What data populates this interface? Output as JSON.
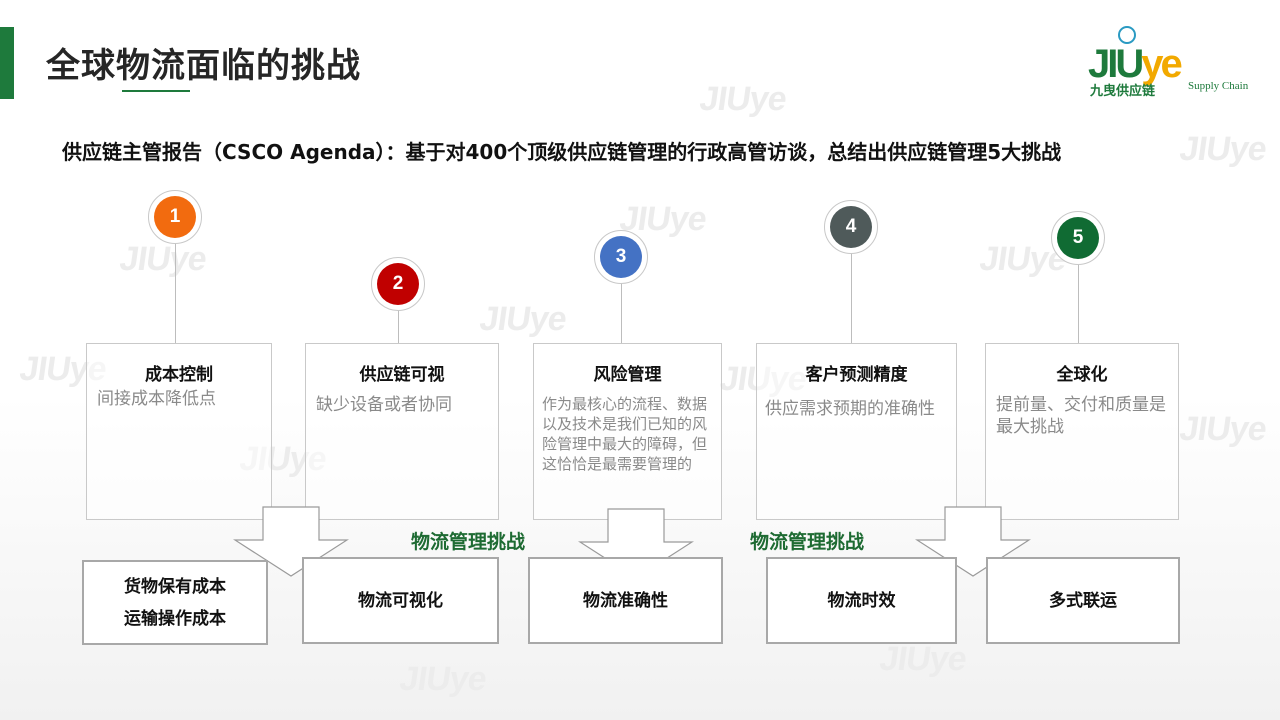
{
  "title": "全球物流面临的挑战",
  "subtitle": "供应链主管报告（CSCO Agenda）：基于对400个顶级供应链管理的行政高管访谈，总结出供应链管理5大挑战",
  "logo": {
    "mark_a": "JIU",
    "mark_b": "ye",
    "cn": "九曳供应链",
    "en": "Supply Chain"
  },
  "watermark_text": "JIUye",
  "challenges": [
    {
      "num": "1",
      "color": "#f26b0f",
      "title": "成本控制",
      "desc": "间接成本降低点"
    },
    {
      "num": "2",
      "color": "#c00000",
      "title": "供应链可视",
      "desc": "缺少设备或者协同"
    },
    {
      "num": "3",
      "color": "#4472c4",
      "title": "风险管理",
      "desc": "作为最核心的流程、数据以及技术是我们已知的风险管理中最大的障碍，但这恰恰是最需要管理的"
    },
    {
      "num": "4",
      "color": "#4f5a5a",
      "title": "客户预测精度",
      "desc": "供应需求预期的准确性"
    },
    {
      "num": "5",
      "color": "#106b33",
      "title": "全球化",
      "desc": "提前量、交付和质量是最大挑战"
    }
  ],
  "logistics_label_1": "物流管理挑战",
  "logistics_label_2": "物流管理挑战",
  "boxes": [
    {
      "line1": "货物保有成本",
      "line2": "运输操作成本"
    },
    {
      "line1": "物流可视化"
    },
    {
      "line1": "物流准确性"
    },
    {
      "line1": "物流时效"
    },
    {
      "line1": "多式联运"
    }
  ]
}
